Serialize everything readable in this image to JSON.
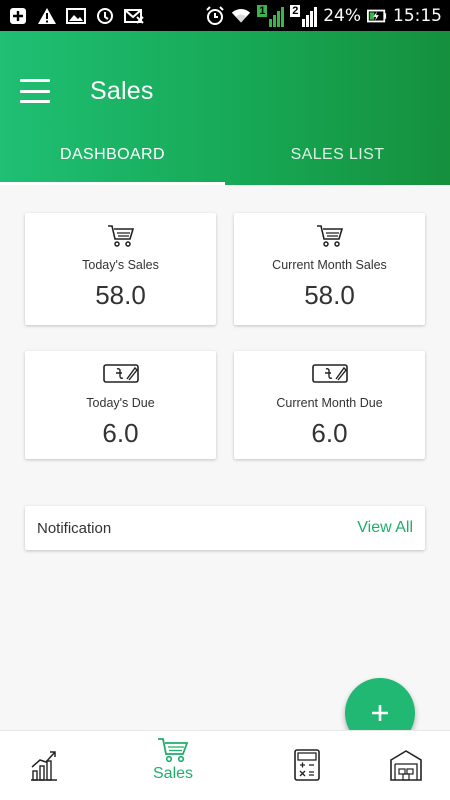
{
  "status_bar": {
    "battery": "24%",
    "time": "15:15",
    "sim1": "1",
    "sim2": "2"
  },
  "app_bar": {
    "title": "Sales"
  },
  "tabs": [
    {
      "label": "DASHBOARD",
      "active": true
    },
    {
      "label": "SALES LIST",
      "active": false
    }
  ],
  "cards": {
    "today_sales": {
      "label": "Today's Sales",
      "value": "58.0",
      "icon": "cart-icon"
    },
    "month_sales": {
      "label": "Current Month Sales",
      "value": "58.0",
      "icon": "cart-icon"
    },
    "today_due": {
      "label": "Today's Due",
      "value": "6.0",
      "icon": "taka-note-icon"
    },
    "month_due": {
      "label": "Current Month Due",
      "value": "6.0",
      "icon": "taka-note-icon"
    }
  },
  "notification": {
    "title": "Notification",
    "action": "View All"
  },
  "bottom_nav": {
    "items": [
      {
        "name": "reports",
        "icon": "chart-icon",
        "label": ""
      },
      {
        "name": "sales",
        "icon": "cart-icon",
        "label": "Sales",
        "active": true
      },
      {
        "name": "calculator",
        "icon": "calculator-icon",
        "label": ""
      },
      {
        "name": "store",
        "icon": "warehouse-icon",
        "label": ""
      }
    ]
  },
  "colors": {
    "accent": "#1fae6a",
    "appbar_start": "#1fbf74",
    "appbar_end": "#15903d",
    "fab": "#21b873"
  }
}
